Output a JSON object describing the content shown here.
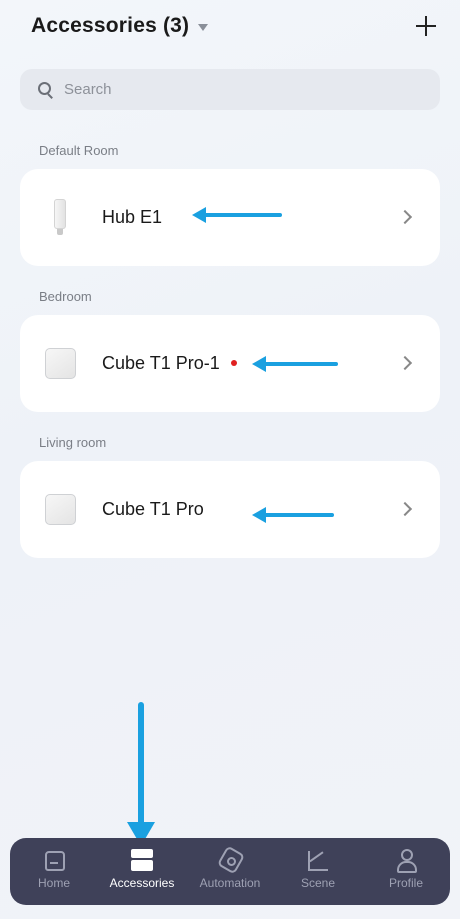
{
  "header": {
    "title": "Accessories (3)"
  },
  "search": {
    "placeholder": "Search"
  },
  "sections": [
    {
      "room": "Default Room",
      "device": "Hub E1",
      "icon": "hub-icon"
    },
    {
      "room": "Bedroom",
      "device": "Cube T1 Pro-1",
      "icon": "cube-icon",
      "status": "alert-dot"
    },
    {
      "room": "Living room",
      "device": "Cube T1 Pro",
      "icon": "cube-icon"
    }
  ],
  "tabbar": {
    "items": [
      {
        "label": "Home",
        "icon": "home-icon"
      },
      {
        "label": "Accessories",
        "icon": "accessories-icon",
        "active": true
      },
      {
        "label": "Automation",
        "icon": "automation-icon"
      },
      {
        "label": "Scene",
        "icon": "scene-icon"
      },
      {
        "label": "Profile",
        "icon": "profile-icon"
      }
    ]
  },
  "colors": {
    "accent": "#1aa0e0",
    "tabbar_bg": "#3f4159",
    "alert": "#e02020"
  }
}
